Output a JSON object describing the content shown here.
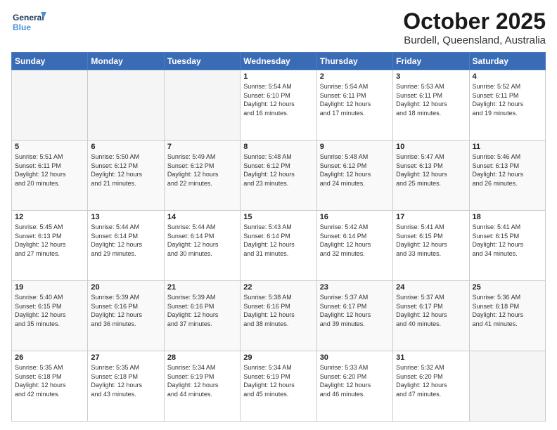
{
  "logo": {
    "line1": "General",
    "line2": "Blue"
  },
  "header": {
    "month": "October 2025",
    "location": "Burdell, Queensland, Australia"
  },
  "weekdays": [
    "Sunday",
    "Monday",
    "Tuesday",
    "Wednesday",
    "Thursday",
    "Friday",
    "Saturday"
  ],
  "weeks": [
    [
      {
        "day": "",
        "info": ""
      },
      {
        "day": "",
        "info": ""
      },
      {
        "day": "",
        "info": ""
      },
      {
        "day": "1",
        "info": "Sunrise: 5:54 AM\nSunset: 6:10 PM\nDaylight: 12 hours\nand 16 minutes."
      },
      {
        "day": "2",
        "info": "Sunrise: 5:54 AM\nSunset: 6:11 PM\nDaylight: 12 hours\nand 17 minutes."
      },
      {
        "day": "3",
        "info": "Sunrise: 5:53 AM\nSunset: 6:11 PM\nDaylight: 12 hours\nand 18 minutes."
      },
      {
        "day": "4",
        "info": "Sunrise: 5:52 AM\nSunset: 6:11 PM\nDaylight: 12 hours\nand 19 minutes."
      }
    ],
    [
      {
        "day": "5",
        "info": "Sunrise: 5:51 AM\nSunset: 6:11 PM\nDaylight: 12 hours\nand 20 minutes."
      },
      {
        "day": "6",
        "info": "Sunrise: 5:50 AM\nSunset: 6:12 PM\nDaylight: 12 hours\nand 21 minutes."
      },
      {
        "day": "7",
        "info": "Sunrise: 5:49 AM\nSunset: 6:12 PM\nDaylight: 12 hours\nand 22 minutes."
      },
      {
        "day": "8",
        "info": "Sunrise: 5:48 AM\nSunset: 6:12 PM\nDaylight: 12 hours\nand 23 minutes."
      },
      {
        "day": "9",
        "info": "Sunrise: 5:48 AM\nSunset: 6:12 PM\nDaylight: 12 hours\nand 24 minutes."
      },
      {
        "day": "10",
        "info": "Sunrise: 5:47 AM\nSunset: 6:13 PM\nDaylight: 12 hours\nand 25 minutes."
      },
      {
        "day": "11",
        "info": "Sunrise: 5:46 AM\nSunset: 6:13 PM\nDaylight: 12 hours\nand 26 minutes."
      }
    ],
    [
      {
        "day": "12",
        "info": "Sunrise: 5:45 AM\nSunset: 6:13 PM\nDaylight: 12 hours\nand 27 minutes."
      },
      {
        "day": "13",
        "info": "Sunrise: 5:44 AM\nSunset: 6:14 PM\nDaylight: 12 hours\nand 29 minutes."
      },
      {
        "day": "14",
        "info": "Sunrise: 5:44 AM\nSunset: 6:14 PM\nDaylight: 12 hours\nand 30 minutes."
      },
      {
        "day": "15",
        "info": "Sunrise: 5:43 AM\nSunset: 6:14 PM\nDaylight: 12 hours\nand 31 minutes."
      },
      {
        "day": "16",
        "info": "Sunrise: 5:42 AM\nSunset: 6:14 PM\nDaylight: 12 hours\nand 32 minutes."
      },
      {
        "day": "17",
        "info": "Sunrise: 5:41 AM\nSunset: 6:15 PM\nDaylight: 12 hours\nand 33 minutes."
      },
      {
        "day": "18",
        "info": "Sunrise: 5:41 AM\nSunset: 6:15 PM\nDaylight: 12 hours\nand 34 minutes."
      }
    ],
    [
      {
        "day": "19",
        "info": "Sunrise: 5:40 AM\nSunset: 6:15 PM\nDaylight: 12 hours\nand 35 minutes."
      },
      {
        "day": "20",
        "info": "Sunrise: 5:39 AM\nSunset: 6:16 PM\nDaylight: 12 hours\nand 36 minutes."
      },
      {
        "day": "21",
        "info": "Sunrise: 5:39 AM\nSunset: 6:16 PM\nDaylight: 12 hours\nand 37 minutes."
      },
      {
        "day": "22",
        "info": "Sunrise: 5:38 AM\nSunset: 6:16 PM\nDaylight: 12 hours\nand 38 minutes."
      },
      {
        "day": "23",
        "info": "Sunrise: 5:37 AM\nSunset: 6:17 PM\nDaylight: 12 hours\nand 39 minutes."
      },
      {
        "day": "24",
        "info": "Sunrise: 5:37 AM\nSunset: 6:17 PM\nDaylight: 12 hours\nand 40 minutes."
      },
      {
        "day": "25",
        "info": "Sunrise: 5:36 AM\nSunset: 6:18 PM\nDaylight: 12 hours\nand 41 minutes."
      }
    ],
    [
      {
        "day": "26",
        "info": "Sunrise: 5:35 AM\nSunset: 6:18 PM\nDaylight: 12 hours\nand 42 minutes."
      },
      {
        "day": "27",
        "info": "Sunrise: 5:35 AM\nSunset: 6:18 PM\nDaylight: 12 hours\nand 43 minutes."
      },
      {
        "day": "28",
        "info": "Sunrise: 5:34 AM\nSunset: 6:19 PM\nDaylight: 12 hours\nand 44 minutes."
      },
      {
        "day": "29",
        "info": "Sunrise: 5:34 AM\nSunset: 6:19 PM\nDaylight: 12 hours\nand 45 minutes."
      },
      {
        "day": "30",
        "info": "Sunrise: 5:33 AM\nSunset: 6:20 PM\nDaylight: 12 hours\nand 46 minutes."
      },
      {
        "day": "31",
        "info": "Sunrise: 5:32 AM\nSunset: 6:20 PM\nDaylight: 12 hours\nand 47 minutes."
      },
      {
        "day": "",
        "info": ""
      }
    ]
  ]
}
